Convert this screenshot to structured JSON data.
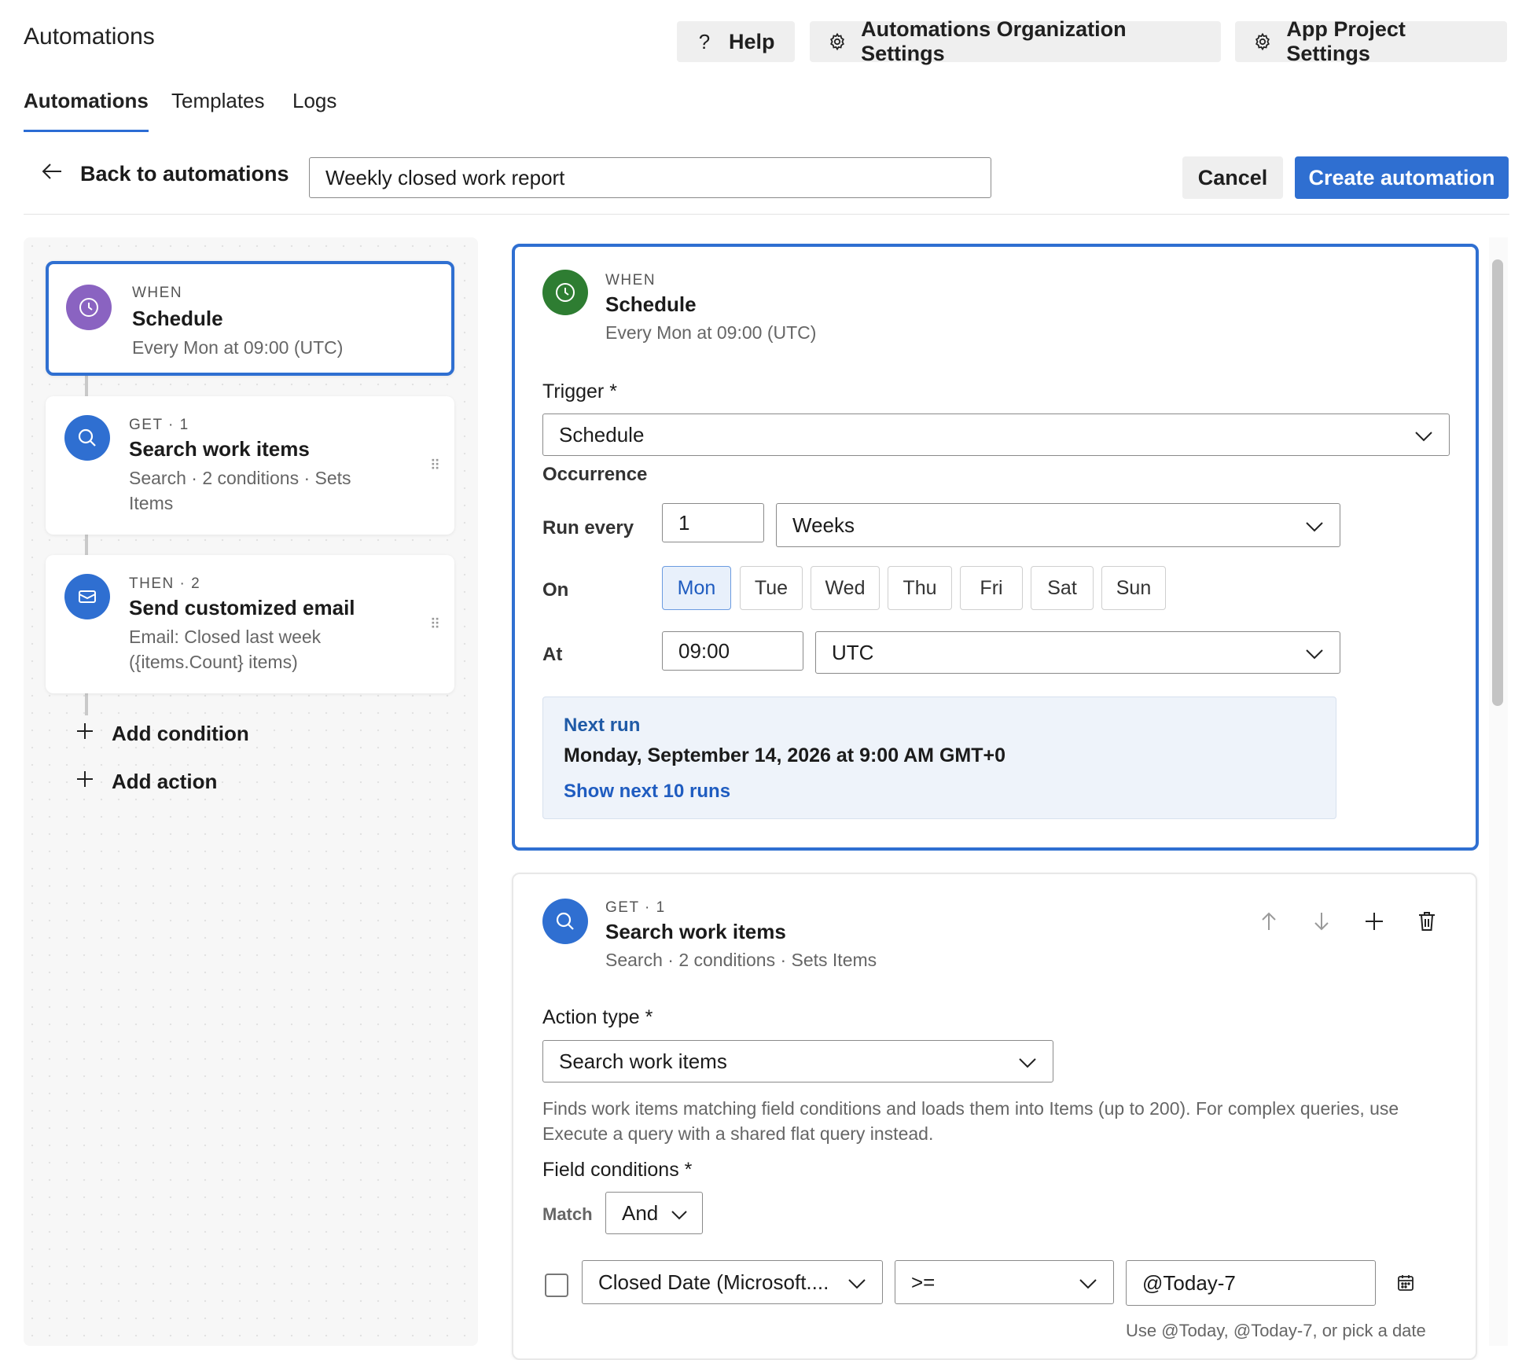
{
  "app": {
    "title": "Automations"
  },
  "header_buttons": {
    "help": "Help",
    "org_settings": "Automations Organization Settings",
    "project_settings": "App Project Settings"
  },
  "tabs": [
    {
      "label": "Automations",
      "active": true
    },
    {
      "label": "Templates",
      "active": false
    },
    {
      "label": "Logs",
      "active": false
    }
  ],
  "toolbar": {
    "back_label": "Back to automations",
    "name_value": "Weekly closed work report",
    "cancel_label": "Cancel",
    "create_label": "Create automation"
  },
  "flow": {
    "steps": [
      {
        "kicker": "WHEN",
        "title": "Schedule",
        "desc": "Every Mon at 09:00 (UTC)",
        "icon": "clock-icon",
        "color": "#8a63c1"
      },
      {
        "kicker": "GET · 1",
        "title": "Search work items",
        "desc": "Search · 2 conditions · Sets Items",
        "icon": "search-icon",
        "color": "#2f6fd1"
      },
      {
        "kicker": "THEN · 2",
        "title": "Send customized email",
        "desc": "Email: Closed last week ({items.Count} items)",
        "icon": "mail-icon",
        "color": "#2f6fd1"
      }
    ],
    "add_condition": "Add condition",
    "add_action": "Add action"
  },
  "trigger_card": {
    "kicker": "WHEN",
    "title": "Schedule",
    "subtitle": "Every Mon at 09:00 (UTC)",
    "icon_color": "#2e7d32",
    "trigger_label": "Trigger *",
    "trigger_value": "Schedule",
    "occurrence_label": "Occurrence",
    "run_every_label": "Run every",
    "run_every_value": "1",
    "run_every_unit": "Weeks",
    "on_label": "On",
    "days": [
      {
        "label": "Mon",
        "selected": true
      },
      {
        "label": "Tue",
        "selected": false
      },
      {
        "label": "Wed",
        "selected": false
      },
      {
        "label": "Thu",
        "selected": false
      },
      {
        "label": "Fri",
        "selected": false
      },
      {
        "label": "Sat",
        "selected": false
      },
      {
        "label": "Sun",
        "selected": false
      }
    ],
    "at_label": "At",
    "at_value": "09:00",
    "timezone": "UTC",
    "next_run": {
      "heading": "Next run",
      "value": "Monday, September 14, 2026 at 9:00 AM GMT+0",
      "link": "Show next 10 runs"
    }
  },
  "action_card": {
    "kicker": "GET · 1",
    "title": "Search work items",
    "subtitle": "Search · 2 conditions · Sets Items",
    "action_type_label": "Action type *",
    "action_type_value": "Search work items",
    "help_text": "Finds work items matching field conditions and loads them into Items (up to 200). For complex queries, use Execute a query with a shared flat query instead.",
    "field_conditions_label": "Field conditions *",
    "match_label": "Match",
    "match_value": "And",
    "condition": {
      "field": "Closed Date (Microsoft....",
      "operator": ">=",
      "value": "@Today-7",
      "hint": "Use @Today, @Today-7, or pick a date"
    }
  },
  "colors": {
    "accent": "#2f6fd1",
    "purple": "#8a63c1",
    "green": "#2e7d32"
  }
}
